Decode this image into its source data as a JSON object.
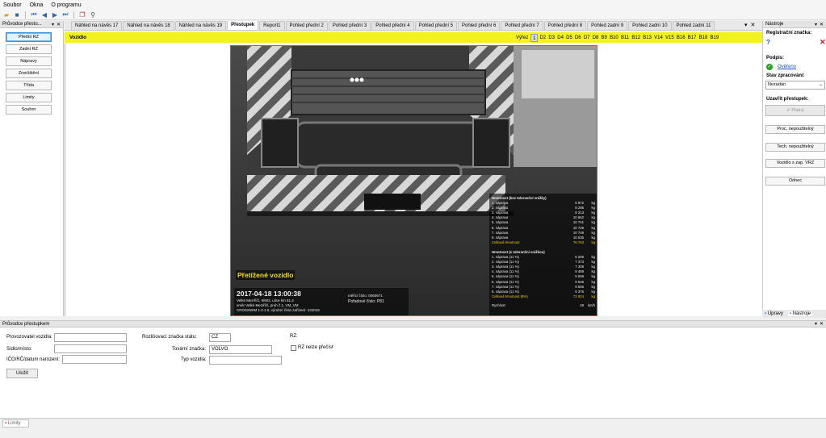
{
  "menu": [
    "Soubor",
    "Okna",
    "O programu"
  ],
  "left_panel": {
    "title": "Průvodce přestu...",
    "items": [
      "Přední RZ",
      "Zadní RZ",
      "Nápravy",
      "Znečištění",
      "Třída",
      "Limity",
      "Souhrn"
    ]
  },
  "tabs": [
    "Náhled na návěs 17",
    "Náhled na návěs 18",
    "Náhled na návěs 19",
    "Přestupek",
    "Report1",
    "Pohled přední 2",
    "Pohled přední 3",
    "Pohled přední 4",
    "Pohled přední 5",
    "Pohled přední 6",
    "Pohled přední 7",
    "Pohled přední 8",
    "Pohled zadní 9",
    "Pohled zadní 10",
    "Pohled zadní 11"
  ],
  "vehicle_bar": {
    "title": "Vozidlo",
    "view_label": "Výřez",
    "views": [
      "1",
      "D2",
      "D3",
      "D4",
      "D5",
      "D6",
      "D7",
      "D8",
      "B9",
      "B10",
      "B11",
      "B12",
      "B13",
      "V14",
      "V15",
      "B16",
      "B17",
      "B18",
      "B19"
    ]
  },
  "photo": {
    "overweight_label": "Přetížené vozidlo",
    "datetime": "2017-04-18 13:00:38",
    "location_lines": [
      "Velké Meziříčí, II/602, ulice km 51.4",
      "směr Velké Meziříčí, pruh č.1, VM_VM",
      "CROSSWIM 1.0.1.0, výrobní číslo zařízení: 122018"
    ],
    "meta_lines": [
      "měřicí číslo: 0060671",
      "Pořadové číslo: P81"
    ],
    "weights_title": "Hmotnost (bez toleranční srážky)",
    "weights": [
      {
        "label": "1. náprava",
        "value": "6 972",
        "unit": "kg"
      },
      {
        "label": "2. náprava",
        "value": "8 285",
        "unit": "kg"
      },
      {
        "label": "3. náprava",
        "value": "8 213",
        "unit": "kg"
      },
      {
        "label": "4. náprava",
        "value": "10 662",
        "unit": "kg"
      },
      {
        "label": "5. náprava",
        "value": "10 741",
        "unit": "kg"
      },
      {
        "label": "6. náprava",
        "value": "10 726",
        "unit": "kg"
      },
      {
        "label": "7. náprava",
        "value": "10 749",
        "unit": "kg"
      },
      {
        "label": "8. náprava",
        "value": "10 535",
        "unit": "kg"
      }
    ],
    "weights_total": {
      "label": "Celková hmotnost",
      "value": "76 763",
      "unit": "kg"
    },
    "tol_title": "Hmotnost (s toleranční srážkou)",
    "tol_weights": [
      {
        "label": "1. náprava (11 %)",
        "value": "6 205",
        "unit": "kg"
      },
      {
        "label": "2. náprava (11 %)",
        "value": "7 373",
        "unit": "kg"
      },
      {
        "label": "3. náprava (11 %)",
        "value": "7 309",
        "unit": "kg"
      },
      {
        "label": "4. náprava (11 %)",
        "value": "9 489",
        "unit": "kg"
      },
      {
        "label": "5. náprava (11 %)",
        "value": "9 559",
        "unit": "kg"
      },
      {
        "label": "6. náprava (11 %)",
        "value": "9 546",
        "unit": "kg"
      },
      {
        "label": "7. náprava (11 %)",
        "value": "9 566",
        "unit": "kg"
      },
      {
        "label": "8. náprava (11 %)",
        "value": "9 376",
        "unit": "kg"
      }
    ],
    "tol_total": {
      "label": "Celková hmotnost (8%)",
      "value": "72 924",
      "unit": "kg"
    },
    "speed": {
      "label": "Rychlost:",
      "value": "48",
      "unit": "km/h"
    }
  },
  "right_panel": {
    "title": "Nástroje",
    "reg_label": "Registrační značka:",
    "reg_value": "?",
    "signature_label": "Podpis:",
    "signature_value": "Ověřeno",
    "status_label": "Stav zpracování:",
    "status_value": "Nezadán",
    "close_label": "Uzavřít přestupek:",
    "close_button": "Platný",
    "buttons": [
      "Proc. nepoužitelný",
      "Tech. nepoužitelný",
      "Vozidlo s zap. VRZ",
      "Odnec"
    ],
    "tabs": [
      "Úpravy",
      "Nástroje"
    ]
  },
  "bottom_panel": {
    "title": "Průvodce přestupkem",
    "fields_left": [
      {
        "label": "Provozovatel vozidla:",
        "value": ""
      },
      {
        "label": "Sídlo/místo:",
        "value": ""
      },
      {
        "label": "IČO/RČ/datum narození:",
        "value": ""
      }
    ],
    "fields_mid": [
      {
        "label": "Rozlišovací značka státu:",
        "value": "CZ"
      },
      {
        "label": "Tovární značka:",
        "value": "VOLVO"
      },
      {
        "label": "Typ vozidla:",
        "value": ""
      }
    ],
    "rz_label": "RZ:",
    "rz_checkbox": "RZ nelze přečíst",
    "save_button": "Uložit",
    "bottom_tab": "Limity"
  },
  "colors": {
    "accent_yellow": "#f2f21f",
    "active_blue": "#3b8fd8",
    "total_yellow": "#f0d000"
  }
}
